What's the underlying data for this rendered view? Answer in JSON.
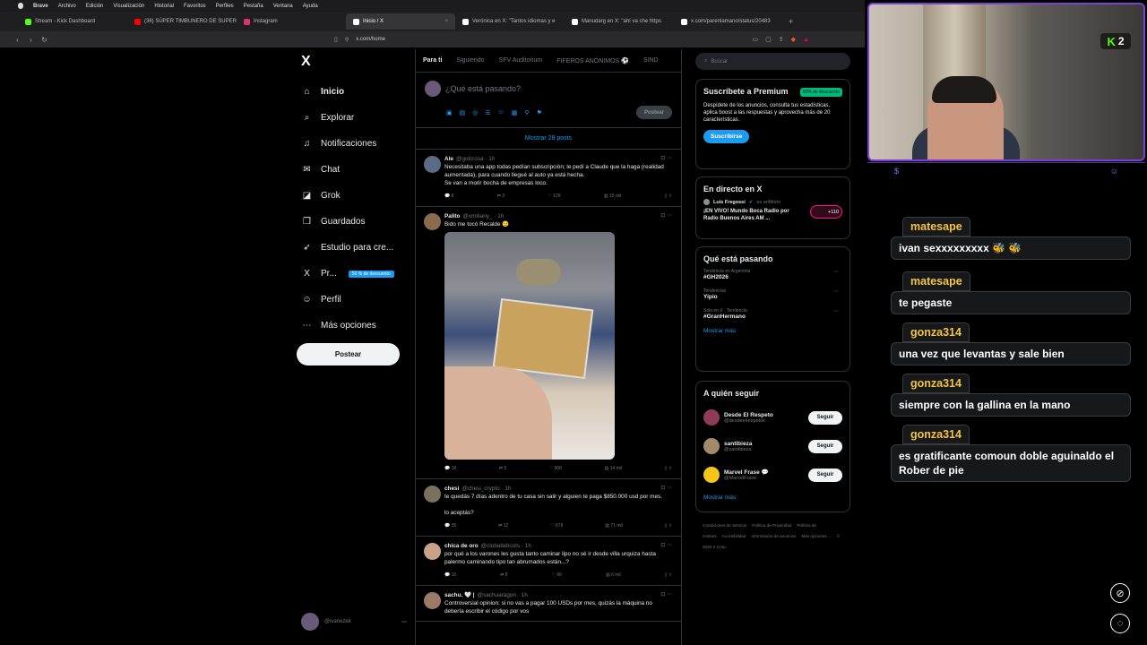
{
  "menubar": {
    "app": "Brave",
    "items": [
      "Archivo",
      "Edición",
      "Visualización",
      "Historial",
      "Favoritos",
      "Perfiles",
      "Pestaña",
      "Ventana",
      "Ayuda"
    ]
  },
  "tabs": [
    {
      "title": "Stream - Kick Dashboard",
      "color": "#53fc18"
    },
    {
      "title": "(36) SÚPER TIMBUNERO DE SUPER",
      "color": "#ff0000"
    },
    {
      "title": "Instagram",
      "color": "#e1306c"
    },
    {
      "title": "Inicio / X",
      "color": "#ffffff",
      "active": true
    },
    {
      "title": "Verónica en X: \"Tantos idiomas y e",
      "color": "#ffffff"
    },
    {
      "title": "Manudarg en X: \"ahí va che https",
      "color": "#ffffff"
    },
    {
      "title": "x.com/parenlamano/status/20483",
      "color": "#ffffff"
    }
  ],
  "address": {
    "url": "x.com/home"
  },
  "sidebar": {
    "logo": "X",
    "items": [
      {
        "icon": "⌂",
        "label": "Inicio",
        "name": "home"
      },
      {
        "icon": "⌕",
        "label": "Explorar",
        "name": "explore"
      },
      {
        "icon": "♫",
        "label": "Notificaciones",
        "name": "notifications"
      },
      {
        "icon": "✉",
        "label": "Chat",
        "name": "chat"
      },
      {
        "icon": "◪",
        "label": "Grok",
        "name": "grok"
      },
      {
        "icon": "❒",
        "label": "Guardados",
        "name": "bookmarks"
      },
      {
        "icon": "➶",
        "label": "Estudio para cre...",
        "name": "creator-studio"
      },
      {
        "icon": "X",
        "label": "Pr...",
        "name": "premium",
        "badge": "50 % de descuento"
      },
      {
        "icon": "☺",
        "label": "Perfil",
        "name": "profile"
      },
      {
        "icon": "⋯",
        "label": "Más opciones",
        "name": "more"
      }
    ],
    "post_label": "Postear",
    "account_handle": "@ivanezek"
  },
  "timeline": {
    "tabs": [
      "Para ti",
      "Siguiendo",
      "SFV Auditorium",
      "FIFEROS ANÓNIMOS ⚽️",
      "SIND"
    ],
    "composer_placeholder": "¿Qué está pasando?",
    "composer_post": "Postear",
    "show_posts": "Mostrar 28 posts",
    "tweets": [
      {
        "name": "Ale",
        "handle": "@golcrosa · 1h",
        "text": "Necesitaba una app todas pedían subscripción; le pedí a Claude que la haga (realidad aumentada), para cuando llegué al auto ya está hecha.\nSe van a morir bocha de empresas loco.",
        "replies": "8",
        "reposts": "3",
        "likes": "129",
        "views": "15 mil",
        "av": "#5b6b86"
      },
      {
        "name": "Palito",
        "handle": "@xmiliany_ · 1h",
        "text": "Bido me tocó Recalde 😏",
        "replies": "18",
        "reposts": "5",
        "likes": "908",
        "views": "14 mil",
        "av": "#8a6b4f",
        "media": true
      },
      {
        "name": "chesi",
        "handle": "@chesi_crypto · 1h",
        "text": "te quedás 7 días adentro de tu casa sin salir y alguien te paga $850.000 usd por mes.\n\nlo aceptás?",
        "replies": "35",
        "reposts": "12",
        "likes": "678",
        "views": "71 mil",
        "av": "#7a7060"
      },
      {
        "name": "chica de oro",
        "handle": "@clubatleticots · 1h",
        "text": "por qué a los varones les gusta tanto caminar lipo no sé ir desde villa urquiza hasta palermo caminando tipo tan abrumados están...?",
        "replies": "16",
        "reposts": "8",
        "likes": "66",
        "views": "6 mil",
        "av": "#c8a288"
      },
      {
        "name": "sachu. 🤍 |",
        "handle": "@sachuaragon · 1h",
        "text": "Controversial opinion: si no vas a pagar 100 USDs por mes, quizás la máquina no debería escribir el código por vos",
        "replies": "",
        "reposts": "",
        "likes": "",
        "views": "",
        "av": "#9a7b6a"
      }
    ]
  },
  "right": {
    "search_placeholder": "Buscar",
    "premium": {
      "title": "Suscríbete a Premium",
      "badge": "50% de descuento",
      "text": "Despídete de los anuncios, consulta tus estadísticas, aplica boost a las respuestas y aprovecha más de 20 características.",
      "button": "Suscribirse"
    },
    "live": {
      "title": "En directo en X",
      "host": "Luis Fregossi",
      "host_status": "es anfitrión",
      "event": "¡EN VIVO! Mundo Boca Radio por Radio Buenos Aires AM ...",
      "count": "+110"
    },
    "trends": {
      "title": "Qué está pasando",
      "items": [
        {
          "cat": "Tendencia en Argentina",
          "tag": "#GH2026"
        },
        {
          "cat": "Tendencias",
          "tag": "Yipio"
        },
        {
          "cat": "Solo en X · Tendencia",
          "tag": "#GranHermano"
        }
      ],
      "more": "Mostrar más"
    },
    "follow": {
      "title": "A quién seguir",
      "items": [
        {
          "name": "Desde El Respeto",
          "handle": "@desdeelrespetok",
          "av": "#8e3b5a"
        },
        {
          "name": "santibieza",
          "handle": "@santibieza",
          "av": "#a08a6a"
        },
        {
          "name": "Marvel Frase 💬",
          "handle": "@MarvelFrase",
          "av": "#f5c518"
        }
      ],
      "button": "Seguir",
      "more": "Mostrar más"
    },
    "footer": [
      "Condiciones de Servicio",
      "Política de Privacidad",
      "Política de cookies",
      "Accesibilidad",
      "Información de anuncios",
      "Más opciones ...",
      "© 2026 X Corp."
    ]
  },
  "stream": {
    "kick_badge": "K",
    "kick_count": "2",
    "chat": [
      {
        "user": "matesape",
        "msg": "ivan sexxxxxxxxx 🐝 🐝"
      },
      {
        "user": "matesape",
        "msg": "te pegaste"
      },
      {
        "user": "gonza314",
        "msg": "una vez que levantas y sale bien"
      },
      {
        "user": "gonza314",
        "msg": "siempre con la gallina en la mano"
      },
      {
        "user": "gonza314",
        "msg": "es gratificante comoun doble aguinaldo el Rober de pie"
      }
    ]
  }
}
